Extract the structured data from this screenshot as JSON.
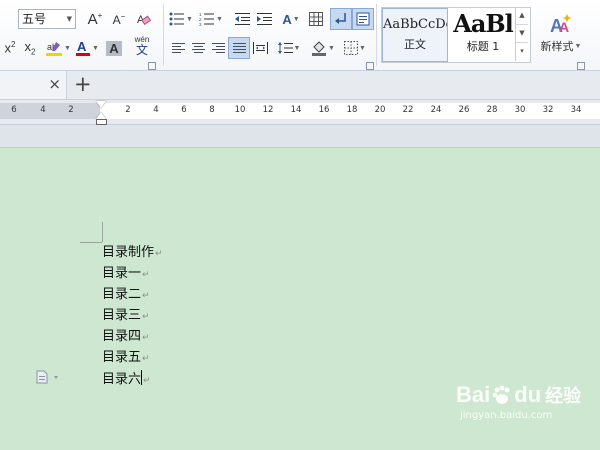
{
  "toolbar": {
    "font_size": "五号",
    "style_normal_sample": "AaBbCcDd",
    "style_normal_label": "正文",
    "style_heading_sample": "AaBl",
    "style_heading_label": "标题 1",
    "new_style_label": "新样式",
    "phonetic_top": "wén",
    "phonetic_bottom": "文",
    "colors": {
      "highlight": "#f2d300",
      "font_color": "#e00000",
      "accent": "#2b5797"
    }
  },
  "tabs": {
    "close_symbol": "×",
    "add_symbol": "+"
  },
  "ruler": {
    "left_numbers": [
      "6",
      "4",
      "2"
    ],
    "numbers": [
      "2",
      "4",
      "6",
      "8",
      "10",
      "12",
      "14",
      "16",
      "18",
      "20",
      "22",
      "24",
      "26",
      "28",
      "30",
      "32",
      "34"
    ]
  },
  "document": {
    "lines": [
      "目录制作",
      "目录一",
      "目录二",
      "目录三",
      "目录四",
      "目录五",
      "目录六"
    ],
    "paragraph_mark": "↵"
  },
  "watermark": {
    "brand": "Bai",
    "brand2": "du",
    "brand3": "经验",
    "url": "jingyan.baidu.com"
  }
}
